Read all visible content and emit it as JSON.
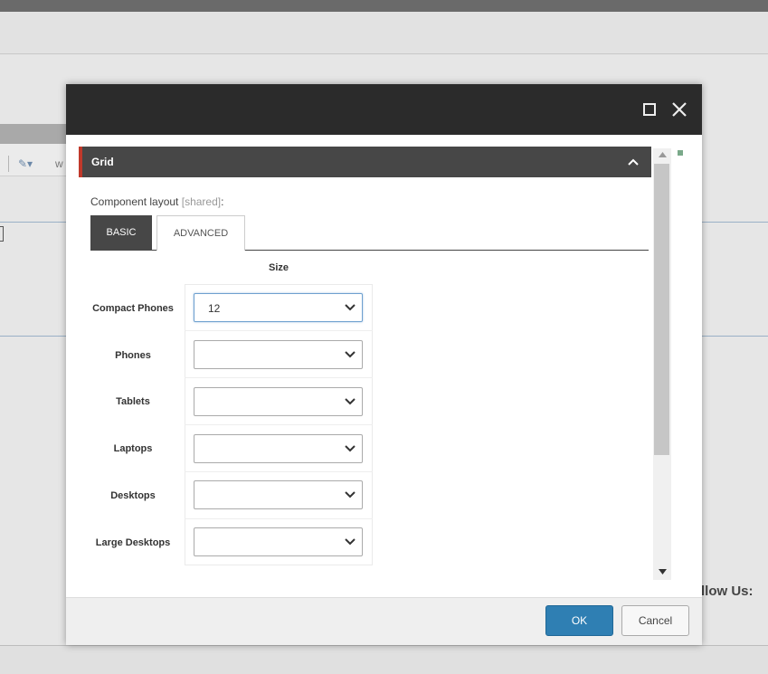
{
  "background": {
    "toolbar_text": "w",
    "follow_text": "llow Us:"
  },
  "dialog": {
    "section": {
      "title": "Grid"
    },
    "field": {
      "label": "Component layout",
      "shared": "[shared]",
      "colon": ":"
    },
    "tabs": [
      {
        "label": "BASIC",
        "active": true
      },
      {
        "label": "ADVANCED",
        "active": false
      }
    ],
    "size_heading": "Size",
    "rows": [
      {
        "label": "Compact Phones",
        "value": "12"
      },
      {
        "label": "Phones",
        "value": ""
      },
      {
        "label": "Tablets",
        "value": ""
      },
      {
        "label": "Laptops",
        "value": ""
      },
      {
        "label": "Desktops",
        "value": ""
      },
      {
        "label": "Large Desktops",
        "value": ""
      }
    ],
    "footer": {
      "ok_label": "OK",
      "cancel_label": "Cancel"
    }
  },
  "colors": {
    "header_bg": "#2b2b2b",
    "section_bg": "#474747",
    "section_accent": "#c0392b",
    "ok_bg": "#2f7fb3"
  }
}
